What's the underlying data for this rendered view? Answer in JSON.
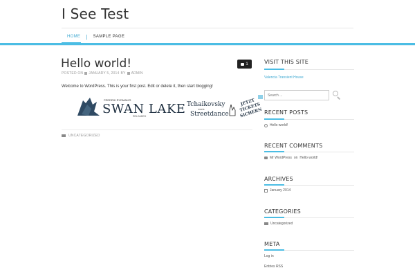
{
  "site": {
    "title": "I See Test"
  },
  "nav": {
    "items": [
      {
        "label": "HOME"
      },
      {
        "label": "SAMPLE PAGE"
      }
    ]
  },
  "post": {
    "title": "Hello world!",
    "comment_count": "1",
    "meta": {
      "posted_on": "POSTED ON",
      "date": "JANUARY 5, 2014",
      "by": "BY",
      "author": "ADMIN"
    },
    "body": "Welcome to WordPress. This is your first post. Edit or delete it, then start blogging!",
    "category": "UNCATEGORIZED",
    "banner": {
      "presenter": "FREDRIK RYDMAN'S",
      "title": "SWAN LAKE",
      "subtitle": "RELOADED",
      "tagline_1": "Tchaikovsky",
      "tagline_2": "meets",
      "tagline_3": "Streetdance",
      "cta_1": "JETZT",
      "cta_2": "TICKETS",
      "cta_3": "SICHERN"
    }
  },
  "sidebar": {
    "visit": {
      "title": "VISIT THIS SITE",
      "link": "Valencia Transient House"
    },
    "search": {
      "placeholder": "Search ..."
    },
    "recent_posts": {
      "title": "RECENT POSTS",
      "items": [
        "Hello world!"
      ]
    },
    "recent_comments": {
      "title": "RECENT COMMENTS",
      "author": "Mr WordPress",
      "on": "on",
      "post": "Hello world!"
    },
    "archives": {
      "title": "ARCHIVES",
      "items": [
        "January 2014"
      ]
    },
    "categories": {
      "title": "CATEGORIES",
      "items": [
        "Uncategorized"
      ]
    },
    "meta": {
      "title": "META",
      "items": [
        "Log in",
        "Entries RSS"
      ]
    }
  },
  "colors": {
    "accent": "#4bbde4",
    "link": "#3fa9d1",
    "text": "#333333"
  },
  "icons": {
    "comment": "comment-icon",
    "calendar": "calendar-icon",
    "user": "user-icon",
    "folder": "folder-icon",
    "search": "search-icon",
    "clock": "clock-icon"
  }
}
